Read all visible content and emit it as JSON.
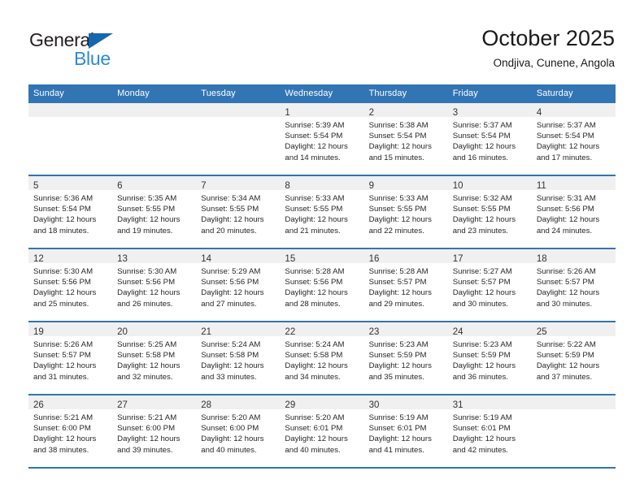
{
  "brand": {
    "name_part1": "General",
    "name_part2": "Blue"
  },
  "header": {
    "title": "October 2025",
    "subtitle": "Ondjiva, Cunene, Angola"
  },
  "colors": {
    "header_blue": "#3175b4",
    "brand_blue": "#2b8bd4",
    "triangle_blue": "#1567b0",
    "daynum_band": "#f0f0f0"
  },
  "weekday_headers": [
    "Sunday",
    "Monday",
    "Tuesday",
    "Wednesday",
    "Thursday",
    "Friday",
    "Saturday"
  ],
  "weeks": [
    [
      {
        "day": "",
        "lines": []
      },
      {
        "day": "",
        "lines": []
      },
      {
        "day": "",
        "lines": []
      },
      {
        "day": "1",
        "lines": [
          "Sunrise: 5:39 AM",
          "Sunset: 5:54 PM",
          "Daylight: 12 hours",
          "and 14 minutes."
        ]
      },
      {
        "day": "2",
        "lines": [
          "Sunrise: 5:38 AM",
          "Sunset: 5:54 PM",
          "Daylight: 12 hours",
          "and 15 minutes."
        ]
      },
      {
        "day": "3",
        "lines": [
          "Sunrise: 5:37 AM",
          "Sunset: 5:54 PM",
          "Daylight: 12 hours",
          "and 16 minutes."
        ]
      },
      {
        "day": "4",
        "lines": [
          "Sunrise: 5:37 AM",
          "Sunset: 5:54 PM",
          "Daylight: 12 hours",
          "and 17 minutes."
        ]
      }
    ],
    [
      {
        "day": "5",
        "lines": [
          "Sunrise: 5:36 AM",
          "Sunset: 5:54 PM",
          "Daylight: 12 hours",
          "and 18 minutes."
        ]
      },
      {
        "day": "6",
        "lines": [
          "Sunrise: 5:35 AM",
          "Sunset: 5:55 PM",
          "Daylight: 12 hours",
          "and 19 minutes."
        ]
      },
      {
        "day": "7",
        "lines": [
          "Sunrise: 5:34 AM",
          "Sunset: 5:55 PM",
          "Daylight: 12 hours",
          "and 20 minutes."
        ]
      },
      {
        "day": "8",
        "lines": [
          "Sunrise: 5:33 AM",
          "Sunset: 5:55 PM",
          "Daylight: 12 hours",
          "and 21 minutes."
        ]
      },
      {
        "day": "9",
        "lines": [
          "Sunrise: 5:33 AM",
          "Sunset: 5:55 PM",
          "Daylight: 12 hours",
          "and 22 minutes."
        ]
      },
      {
        "day": "10",
        "lines": [
          "Sunrise: 5:32 AM",
          "Sunset: 5:55 PM",
          "Daylight: 12 hours",
          "and 23 minutes."
        ]
      },
      {
        "day": "11",
        "lines": [
          "Sunrise: 5:31 AM",
          "Sunset: 5:56 PM",
          "Daylight: 12 hours",
          "and 24 minutes."
        ]
      }
    ],
    [
      {
        "day": "12",
        "lines": [
          "Sunrise: 5:30 AM",
          "Sunset: 5:56 PM",
          "Daylight: 12 hours",
          "and 25 minutes."
        ]
      },
      {
        "day": "13",
        "lines": [
          "Sunrise: 5:30 AM",
          "Sunset: 5:56 PM",
          "Daylight: 12 hours",
          "and 26 minutes."
        ]
      },
      {
        "day": "14",
        "lines": [
          "Sunrise: 5:29 AM",
          "Sunset: 5:56 PM",
          "Daylight: 12 hours",
          "and 27 minutes."
        ]
      },
      {
        "day": "15",
        "lines": [
          "Sunrise: 5:28 AM",
          "Sunset: 5:56 PM",
          "Daylight: 12 hours",
          "and 28 minutes."
        ]
      },
      {
        "day": "16",
        "lines": [
          "Sunrise: 5:28 AM",
          "Sunset: 5:57 PM",
          "Daylight: 12 hours",
          "and 29 minutes."
        ]
      },
      {
        "day": "17",
        "lines": [
          "Sunrise: 5:27 AM",
          "Sunset: 5:57 PM",
          "Daylight: 12 hours",
          "and 30 minutes."
        ]
      },
      {
        "day": "18",
        "lines": [
          "Sunrise: 5:26 AM",
          "Sunset: 5:57 PM",
          "Daylight: 12 hours",
          "and 30 minutes."
        ]
      }
    ],
    [
      {
        "day": "19",
        "lines": [
          "Sunrise: 5:26 AM",
          "Sunset: 5:57 PM",
          "Daylight: 12 hours",
          "and 31 minutes."
        ]
      },
      {
        "day": "20",
        "lines": [
          "Sunrise: 5:25 AM",
          "Sunset: 5:58 PM",
          "Daylight: 12 hours",
          "and 32 minutes."
        ]
      },
      {
        "day": "21",
        "lines": [
          "Sunrise: 5:24 AM",
          "Sunset: 5:58 PM",
          "Daylight: 12 hours",
          "and 33 minutes."
        ]
      },
      {
        "day": "22",
        "lines": [
          "Sunrise: 5:24 AM",
          "Sunset: 5:58 PM",
          "Daylight: 12 hours",
          "and 34 minutes."
        ]
      },
      {
        "day": "23",
        "lines": [
          "Sunrise: 5:23 AM",
          "Sunset: 5:59 PM",
          "Daylight: 12 hours",
          "and 35 minutes."
        ]
      },
      {
        "day": "24",
        "lines": [
          "Sunrise: 5:23 AM",
          "Sunset: 5:59 PM",
          "Daylight: 12 hours",
          "and 36 minutes."
        ]
      },
      {
        "day": "25",
        "lines": [
          "Sunrise: 5:22 AM",
          "Sunset: 5:59 PM",
          "Daylight: 12 hours",
          "and 37 minutes."
        ]
      }
    ],
    [
      {
        "day": "26",
        "lines": [
          "Sunrise: 5:21 AM",
          "Sunset: 6:00 PM",
          "Daylight: 12 hours",
          "and 38 minutes."
        ]
      },
      {
        "day": "27",
        "lines": [
          "Sunrise: 5:21 AM",
          "Sunset: 6:00 PM",
          "Daylight: 12 hours",
          "and 39 minutes."
        ]
      },
      {
        "day": "28",
        "lines": [
          "Sunrise: 5:20 AM",
          "Sunset: 6:00 PM",
          "Daylight: 12 hours",
          "and 40 minutes."
        ]
      },
      {
        "day": "29",
        "lines": [
          "Sunrise: 5:20 AM",
          "Sunset: 6:01 PM",
          "Daylight: 12 hours",
          "and 40 minutes."
        ]
      },
      {
        "day": "30",
        "lines": [
          "Sunrise: 5:19 AM",
          "Sunset: 6:01 PM",
          "Daylight: 12 hours",
          "and 41 minutes."
        ]
      },
      {
        "day": "31",
        "lines": [
          "Sunrise: 5:19 AM",
          "Sunset: 6:01 PM",
          "Daylight: 12 hours",
          "and 42 minutes."
        ]
      },
      {
        "day": "",
        "lines": []
      }
    ]
  ]
}
